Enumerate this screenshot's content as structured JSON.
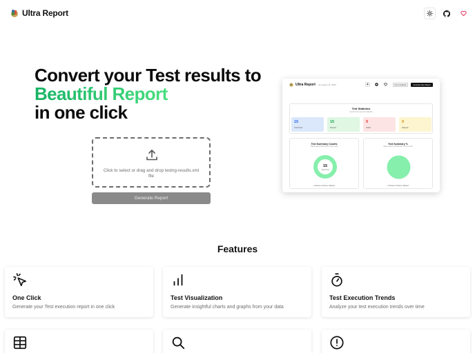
{
  "header": {
    "brand": "Ultra Report",
    "logo_icon": "ultra-report-logo",
    "buttons": [
      "sun-icon",
      "github-icon",
      "heart-icon"
    ]
  },
  "hero": {
    "line1": "Convert your Test results to",
    "line2": "Beautiful Report",
    "line3": "in one click",
    "accent_color": "#22c55e"
  },
  "upload": {
    "icon": "upload-icon",
    "text": "Click to select or drag and drop testng-results.xml file",
    "button_label": "Generate Report"
  },
  "preview": {
    "brand": "Ultra Report",
    "date": "for August 11, 2023",
    "new_feedback": "New Feedback",
    "generate": "Generate New Report",
    "stats_title": "Test Statistics",
    "stats_sub": "Overall Test execution Statistics",
    "cards": [
      {
        "value": "15",
        "label": "Total Tests",
        "bg": "#dbe8fb",
        "fg": "#2563eb"
      },
      {
        "value": "15",
        "label": "Passed",
        "bg": "#dff7e3",
        "fg": "#16a34a"
      },
      {
        "value": "0",
        "label": "Failed",
        "bg": "#fde4e4",
        "fg": "#dc2626"
      },
      {
        "value": "0",
        "label": "Skipped",
        "bg": "#fdf5cf",
        "fg": "#ca8a04"
      }
    ],
    "panel1": {
      "title": "Test Summary Counts",
      "sub": "Status based distribution of Test results",
      "center_value": "15",
      "center_label": "Total Tests",
      "legend": "● Passed  ● Failed  ● Skipped"
    },
    "panel2": {
      "title": "Test Summary %",
      "sub": "Status based % distribution of Test results",
      "legend": "● Passed  ● Failed  ● Skipped"
    }
  },
  "features": {
    "title": "Features",
    "items": [
      {
        "title": "One Click",
        "desc": "Generate your Test execution report in one click",
        "icon": "pointer-click-icon"
      },
      {
        "title": "Test Visualization",
        "desc": "Generate insightful charts and graphs from your data",
        "icon": "bar-chart-icon"
      },
      {
        "title": "Test Execution Trends",
        "desc": "Analyze your test execution trends over time",
        "icon": "stopwatch-icon"
      },
      {
        "title": "",
        "desc": "",
        "icon": "table-icon"
      },
      {
        "title": "",
        "desc": "",
        "icon": "search-icon"
      },
      {
        "title": "",
        "desc": "",
        "icon": "alert-circle-icon"
      }
    ]
  }
}
